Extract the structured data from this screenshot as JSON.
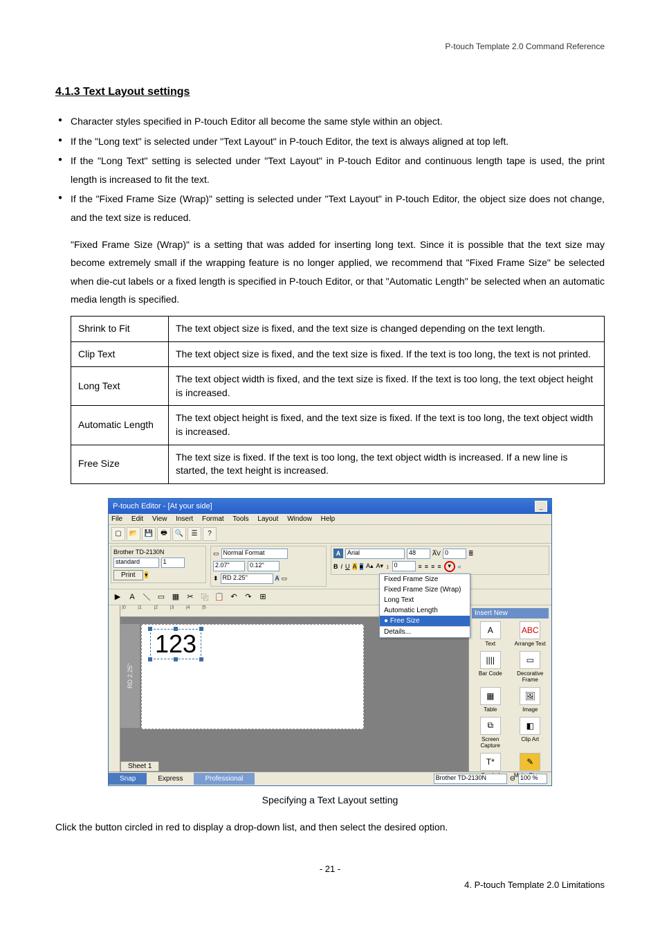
{
  "header": {
    "doc_title": "P-touch Template 2.0 Command Reference"
  },
  "section": {
    "title": "4.1.3 Text Layout settings",
    "bullets": [
      "Character styles specified in P-touch Editor all become the same style within an object.",
      "If the \"Long text\" is selected under \"Text Layout\" in P-touch Editor, the text is always aligned at top left.",
      "If the \"Long Text\" setting is selected under \"Text Layout\" in P-touch Editor and continuous length tape is used, the print length is increased to fit the text.",
      "If the \"Fixed Frame Size (Wrap)\" setting is selected under \"Text Layout\" in P-touch Editor, the object size does not change, and the text size is reduced."
    ],
    "sub_para": "\"Fixed Frame Size (Wrap)\" is a setting that was added for inserting long text. Since it is possible that the text size may become extremely small if the wrapping feature is no longer applied, we recommend that \"Fixed Frame Size\" be selected when die-cut labels or a fixed length is specified in P-touch Editor, or that \"Automatic Length\" be selected when an automatic media length is specified.",
    "table": [
      {
        "key": "Shrink to Fit",
        "val": "The text object size is fixed, and the text size is changed depending on the text length."
      },
      {
        "key": "Clip Text",
        "val": "The text object size is fixed, and the text size is fixed. If the text is too long, the text is not printed."
      },
      {
        "key": "Long Text",
        "val": "The text object width is fixed, and the text size is fixed. If the text is too long, the text object height is increased."
      },
      {
        "key": "Automatic Length",
        "val": "The text object height is fixed, and the text size is fixed. If the text is too long, the text object width is increased."
      },
      {
        "key": "Free Size",
        "val": "The text size is fixed. If the text is too long, the text object width is increased. If a new line is started, the text height is increased."
      }
    ]
  },
  "screenshot": {
    "title": "P-touch Editor - [At your side]",
    "menus": [
      "File",
      "Edit",
      "View",
      "Insert",
      "Format",
      "Tools",
      "Layout",
      "Window",
      "Help"
    ],
    "printer_label": "Brother TD-2130N",
    "format_label": "Normal Format",
    "paper_combo": "standard",
    "copies": "1",
    "print_btn": "Print",
    "width_val": "2.07\"",
    "margin_val": "0.12\"",
    "media_combo": "RD 2.25\"",
    "font_name": "Arial",
    "font_size": "48",
    "av_val": "0",
    "ls_val": "0",
    "dropdown": {
      "items": [
        "Fixed Frame Size",
        "Fixed Frame Size (Wrap)",
        "Long Text",
        "Automatic Length",
        "Free Size",
        "Details..."
      ],
      "selected_index": 4
    },
    "canvas_text": "123",
    "media_side": "RD 2.25\"",
    "sheet_tab": "Sheet 1",
    "sidebar_title": "Insert New",
    "sidebar_items": [
      "Text",
      "Arrange Text",
      "Bar Code",
      "Decorative Frame",
      "Table",
      "Image",
      "Screen Capture",
      "Clip Art",
      "Symbol",
      "Make Picture"
    ],
    "modes": {
      "snap": "Snap",
      "express": "Express",
      "pro": "Professional"
    },
    "status_printer": "Brother TD-2130N",
    "zoom": "100 %"
  },
  "caption": "Specifying a Text Layout setting",
  "final": "Click the button circled in red to display a drop-down list, and then select the desired option.",
  "footer": {
    "page": "- 21 -",
    "section": "4. P-touch Template 2.0 Limitations"
  }
}
